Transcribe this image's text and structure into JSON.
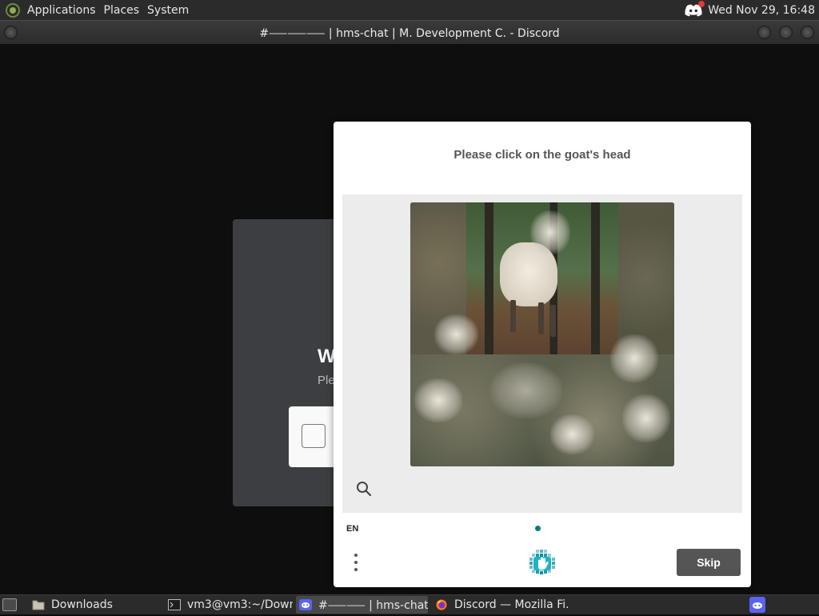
{
  "top_panel": {
    "menus": [
      "Applications",
      "Places",
      "System"
    ],
    "clock": "Wed Nov 29, 16:48"
  },
  "window": {
    "title": "#⸺⸺⸺ | hms-chat | M. Development C. - Discord"
  },
  "discord": {
    "heading": "W",
    "subtitle": "Ple"
  },
  "challenge": {
    "prompt": "Please click on the goat's head",
    "language": "EN",
    "skip_label": "Skip"
  },
  "taskbar": {
    "tasks": [
      {
        "label": "Downloads",
        "icon": "folder-icon"
      },
      {
        "label": "vm3@vm3:~/Downl...",
        "icon": "terminal-icon"
      },
      {
        "label": "#⸺⸺ | hms-chat | ...",
        "icon": "discord-icon"
      },
      {
        "label": "Discord — Mozilla Fi...",
        "icon": "firefox-icon"
      }
    ]
  },
  "colors": {
    "accent_teal": "#0f7c78",
    "discord_blurple": "#5865f2",
    "skip_button": "#555555"
  }
}
